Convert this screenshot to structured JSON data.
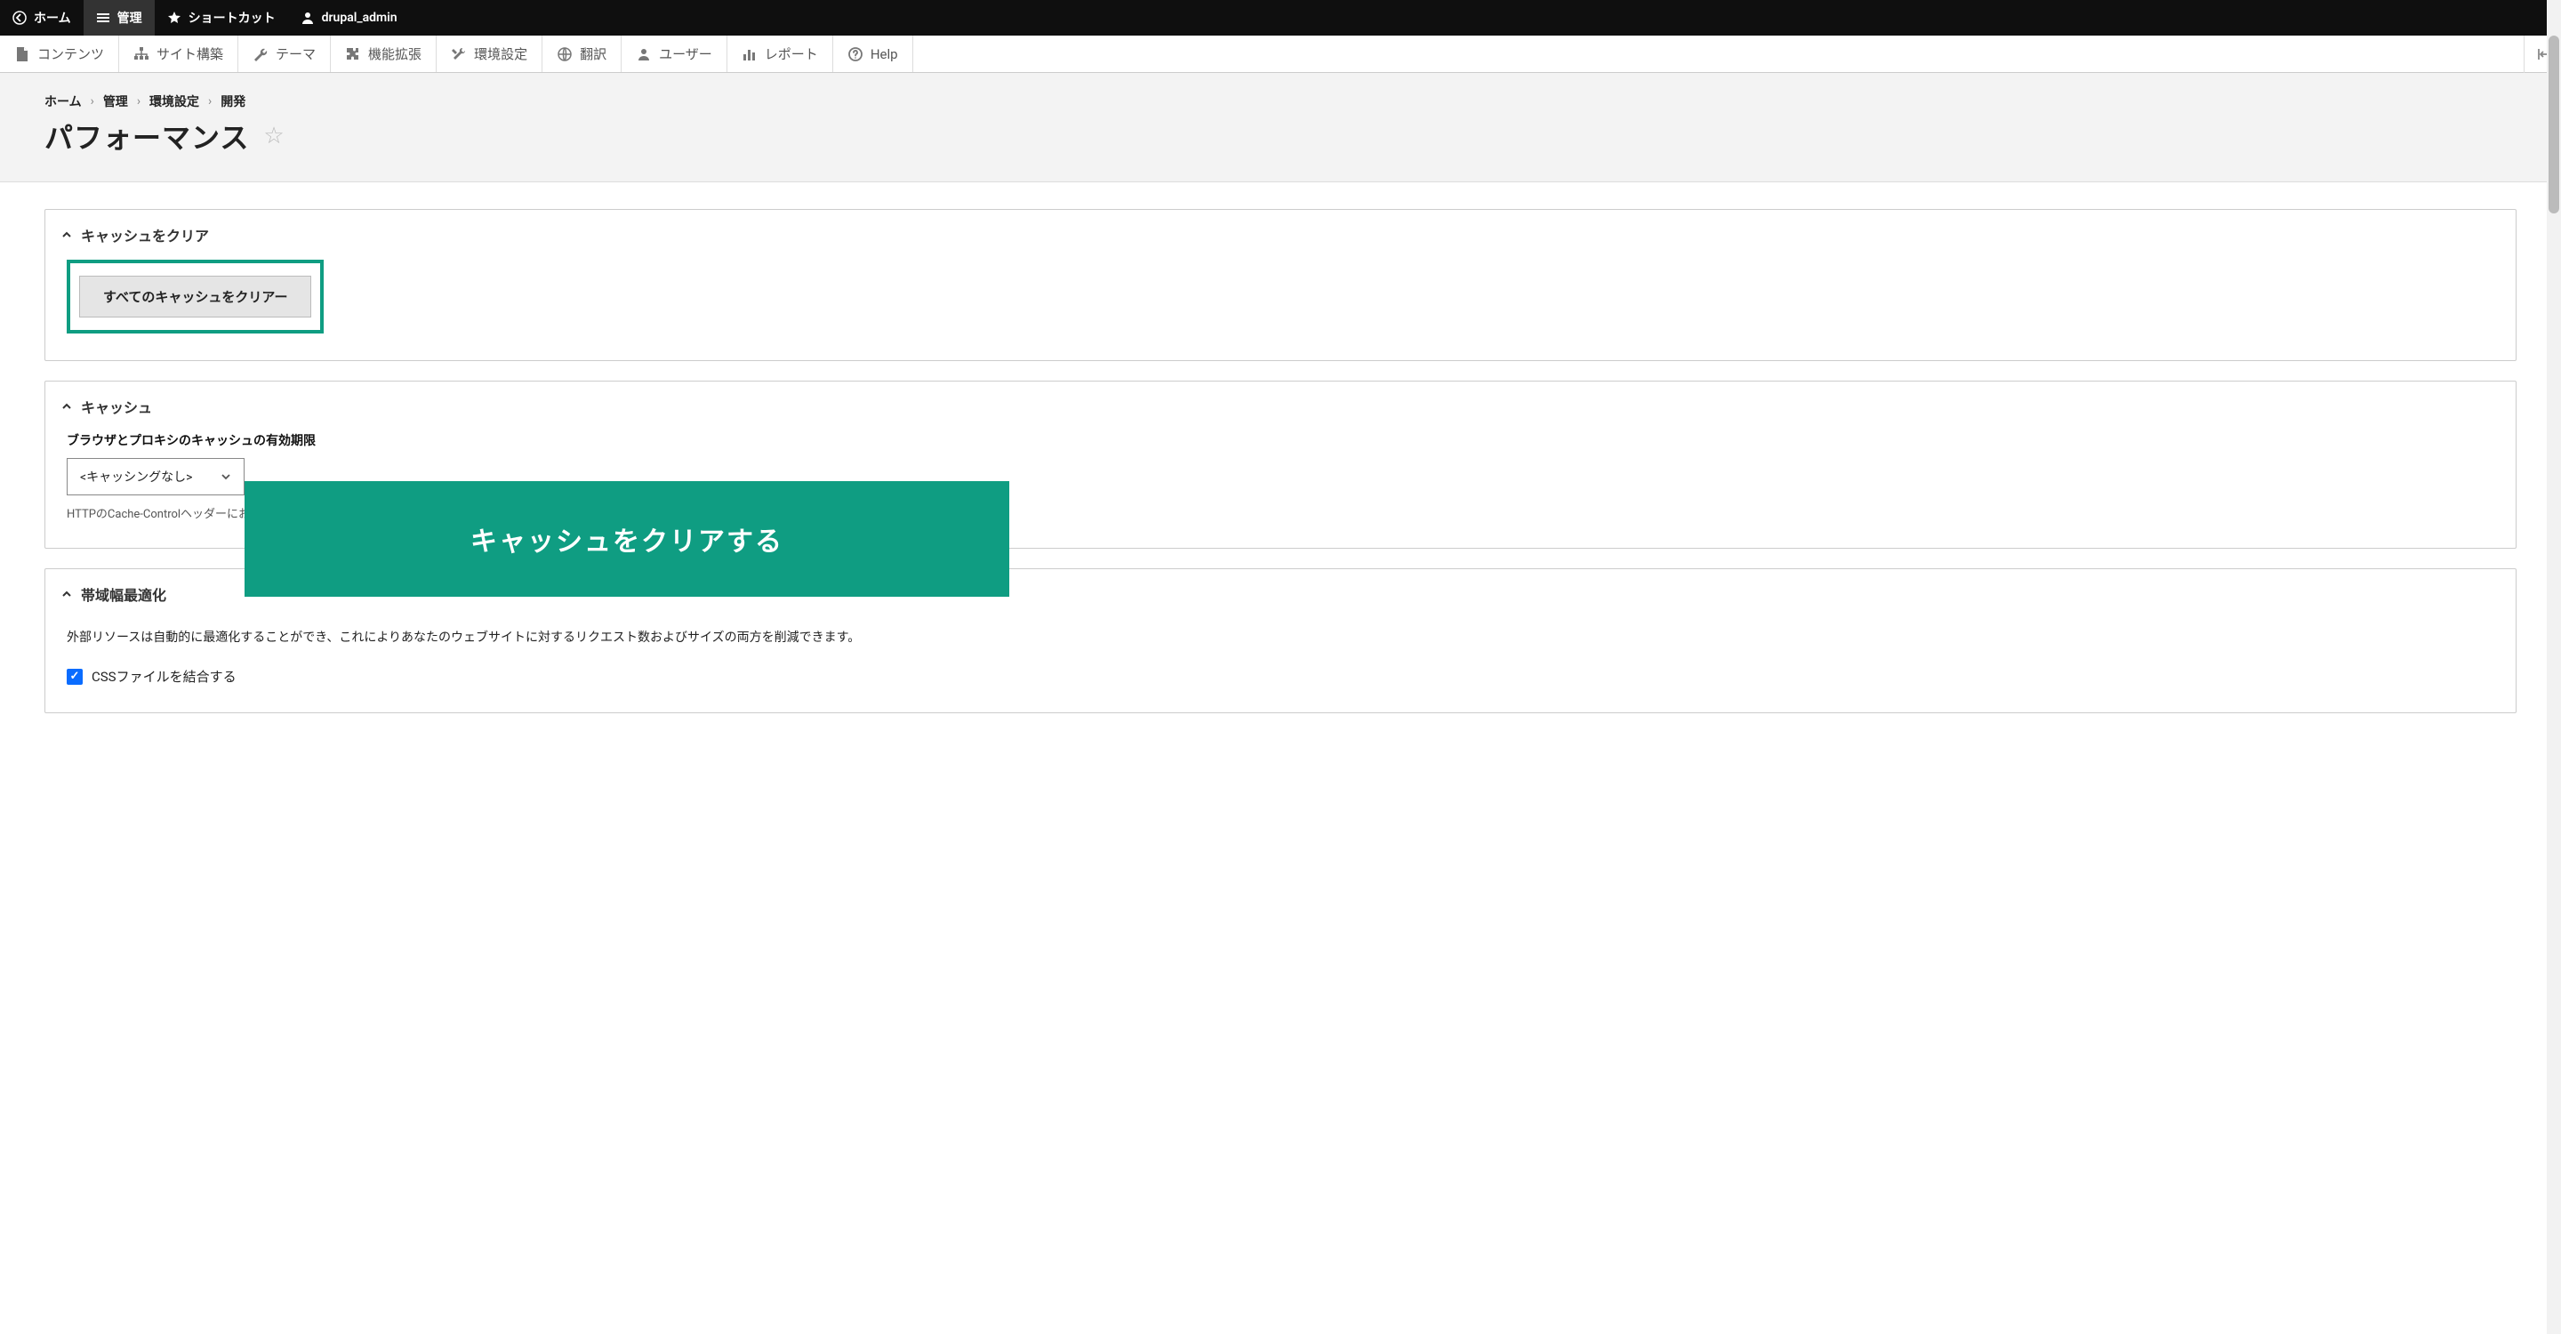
{
  "topbar": {
    "home": "ホーム",
    "manage": "管理",
    "shortcuts": "ショートカット",
    "user": "drupal_admin"
  },
  "subbar": {
    "content": "コンテンツ",
    "structure": "サイト構築",
    "appearance": "テーマ",
    "extend": "機能拡張",
    "configuration": "環境設定",
    "translate": "翻訳",
    "people": "ユーザー",
    "reports": "レポート",
    "help": "Help"
  },
  "breadcrumb": {
    "items": [
      "ホーム",
      "管理",
      "環境設定",
      "開発"
    ]
  },
  "page_title": "パフォーマンス",
  "sections": {
    "clear_cache": {
      "legend": "キャッシュをクリア",
      "button": "すべてのキャッシュをクリアー"
    },
    "caching": {
      "legend": "キャッシュ",
      "field_label": "ブラウザとプロキシのキャッシュの有効期限",
      "select_value": "<キャッシングなし>",
      "help": "HTTPのCache-Controlヘッダーにおける"
    },
    "bandwidth": {
      "legend": "帯域幅最適化",
      "description": "外部リソースは自動的に最適化することができ、これによりあなたのウェブサイトに対するリクエスト数およびサイズの両方を削減できます。",
      "checkbox_css_label": "CSSファイルを結合する"
    }
  },
  "overlay_callout": "キャッシュをクリアする"
}
